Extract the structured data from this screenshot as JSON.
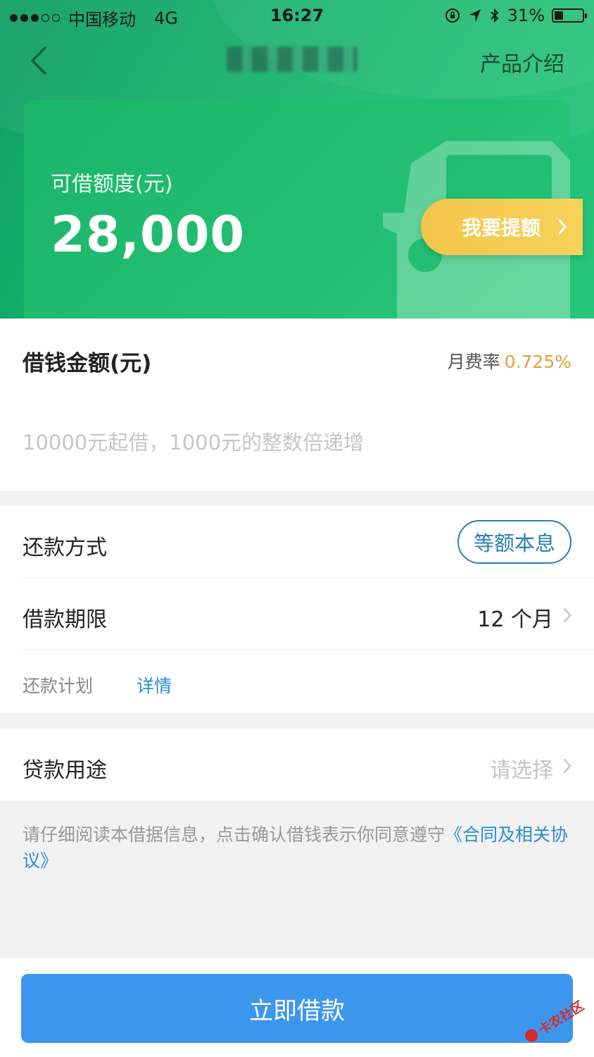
{
  "status_bar": {
    "carrier": "中国移动",
    "network": "4G",
    "time": "16:27",
    "battery": "31%",
    "battery_level": 0.31
  },
  "nav": {
    "intro_label": "产品介绍"
  },
  "card": {
    "label": "可借额度(元)",
    "amount": "28,000",
    "boost_label": "我要提额"
  },
  "loan": {
    "title": "借钱金额(元)",
    "rate_label": "月费率",
    "rate_value": "0.725%",
    "amount_value": "",
    "amount_placeholder": "10000元起借，1000元的整数倍递增"
  },
  "repayment": {
    "label": "还款方式",
    "method": "等额本息"
  },
  "term": {
    "label": "借款期限",
    "value": "12 个月"
  },
  "plan": {
    "label": "还款计划",
    "link": "详情"
  },
  "purpose": {
    "label": "贷款用途",
    "placeholder": "请选择"
  },
  "agreement": {
    "text": "请仔细阅读本借据信息，点击确认借钱表示你同意遵守",
    "link": "《合同及相关协议》"
  },
  "submit_label": "立即借款",
  "watermark": "卡农社区",
  "colors": {
    "brand_green": "#1cb56b",
    "boost_yellow": "#f3c64a",
    "rate_orange": "#e0a23a",
    "link_blue": "#2a8ed0",
    "button_blue": "#3d96ee"
  }
}
